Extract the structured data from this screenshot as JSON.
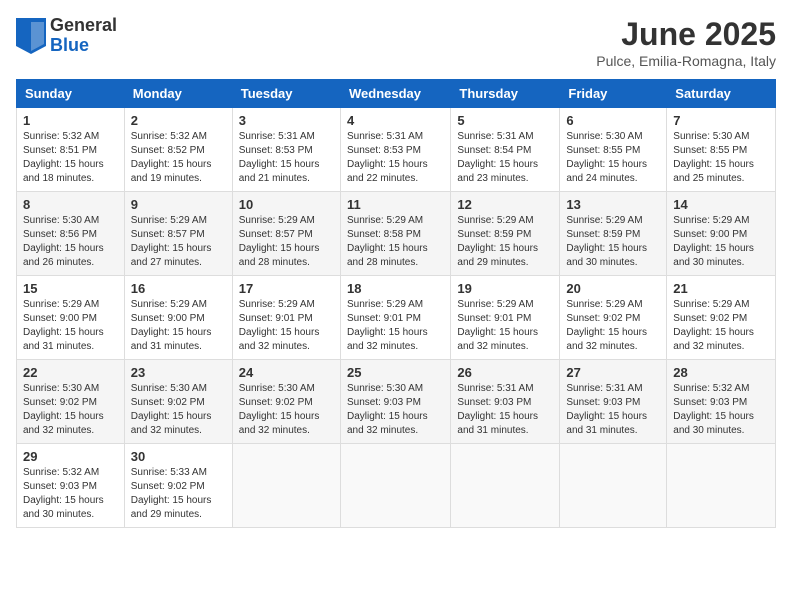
{
  "header": {
    "logo_general": "General",
    "logo_blue": "Blue",
    "month_title": "June 2025",
    "location": "Pulce, Emilia-Romagna, Italy"
  },
  "columns": [
    "Sunday",
    "Monday",
    "Tuesday",
    "Wednesday",
    "Thursday",
    "Friday",
    "Saturday"
  ],
  "weeks": [
    [
      {
        "day": "1",
        "info": "Sunrise: 5:32 AM\nSunset: 8:51 PM\nDaylight: 15 hours\nand 18 minutes."
      },
      {
        "day": "2",
        "info": "Sunrise: 5:32 AM\nSunset: 8:52 PM\nDaylight: 15 hours\nand 19 minutes."
      },
      {
        "day": "3",
        "info": "Sunrise: 5:31 AM\nSunset: 8:53 PM\nDaylight: 15 hours\nand 21 minutes."
      },
      {
        "day": "4",
        "info": "Sunrise: 5:31 AM\nSunset: 8:53 PM\nDaylight: 15 hours\nand 22 minutes."
      },
      {
        "day": "5",
        "info": "Sunrise: 5:31 AM\nSunset: 8:54 PM\nDaylight: 15 hours\nand 23 minutes."
      },
      {
        "day": "6",
        "info": "Sunrise: 5:30 AM\nSunset: 8:55 PM\nDaylight: 15 hours\nand 24 minutes."
      },
      {
        "day": "7",
        "info": "Sunrise: 5:30 AM\nSunset: 8:55 PM\nDaylight: 15 hours\nand 25 minutes."
      }
    ],
    [
      {
        "day": "8",
        "info": "Sunrise: 5:30 AM\nSunset: 8:56 PM\nDaylight: 15 hours\nand 26 minutes."
      },
      {
        "day": "9",
        "info": "Sunrise: 5:29 AM\nSunset: 8:57 PM\nDaylight: 15 hours\nand 27 minutes."
      },
      {
        "day": "10",
        "info": "Sunrise: 5:29 AM\nSunset: 8:57 PM\nDaylight: 15 hours\nand 28 minutes."
      },
      {
        "day": "11",
        "info": "Sunrise: 5:29 AM\nSunset: 8:58 PM\nDaylight: 15 hours\nand 28 minutes."
      },
      {
        "day": "12",
        "info": "Sunrise: 5:29 AM\nSunset: 8:59 PM\nDaylight: 15 hours\nand 29 minutes."
      },
      {
        "day": "13",
        "info": "Sunrise: 5:29 AM\nSunset: 8:59 PM\nDaylight: 15 hours\nand 30 minutes."
      },
      {
        "day": "14",
        "info": "Sunrise: 5:29 AM\nSunset: 9:00 PM\nDaylight: 15 hours\nand 30 minutes."
      }
    ],
    [
      {
        "day": "15",
        "info": "Sunrise: 5:29 AM\nSunset: 9:00 PM\nDaylight: 15 hours\nand 31 minutes."
      },
      {
        "day": "16",
        "info": "Sunrise: 5:29 AM\nSunset: 9:00 PM\nDaylight: 15 hours\nand 31 minutes."
      },
      {
        "day": "17",
        "info": "Sunrise: 5:29 AM\nSunset: 9:01 PM\nDaylight: 15 hours\nand 32 minutes."
      },
      {
        "day": "18",
        "info": "Sunrise: 5:29 AM\nSunset: 9:01 PM\nDaylight: 15 hours\nand 32 minutes."
      },
      {
        "day": "19",
        "info": "Sunrise: 5:29 AM\nSunset: 9:01 PM\nDaylight: 15 hours\nand 32 minutes."
      },
      {
        "day": "20",
        "info": "Sunrise: 5:29 AM\nSunset: 9:02 PM\nDaylight: 15 hours\nand 32 minutes."
      },
      {
        "day": "21",
        "info": "Sunrise: 5:29 AM\nSunset: 9:02 PM\nDaylight: 15 hours\nand 32 minutes."
      }
    ],
    [
      {
        "day": "22",
        "info": "Sunrise: 5:30 AM\nSunset: 9:02 PM\nDaylight: 15 hours\nand 32 minutes."
      },
      {
        "day": "23",
        "info": "Sunrise: 5:30 AM\nSunset: 9:02 PM\nDaylight: 15 hours\nand 32 minutes."
      },
      {
        "day": "24",
        "info": "Sunrise: 5:30 AM\nSunset: 9:02 PM\nDaylight: 15 hours\nand 32 minutes."
      },
      {
        "day": "25",
        "info": "Sunrise: 5:30 AM\nSunset: 9:03 PM\nDaylight: 15 hours\nand 32 minutes."
      },
      {
        "day": "26",
        "info": "Sunrise: 5:31 AM\nSunset: 9:03 PM\nDaylight: 15 hours\nand 31 minutes."
      },
      {
        "day": "27",
        "info": "Sunrise: 5:31 AM\nSunset: 9:03 PM\nDaylight: 15 hours\nand 31 minutes."
      },
      {
        "day": "28",
        "info": "Sunrise: 5:32 AM\nSunset: 9:03 PM\nDaylight: 15 hours\nand 30 minutes."
      }
    ],
    [
      {
        "day": "29",
        "info": "Sunrise: 5:32 AM\nSunset: 9:03 PM\nDaylight: 15 hours\nand 30 minutes."
      },
      {
        "day": "30",
        "info": "Sunrise: 5:33 AM\nSunset: 9:02 PM\nDaylight: 15 hours\nand 29 minutes."
      },
      {
        "day": "",
        "info": ""
      },
      {
        "day": "",
        "info": ""
      },
      {
        "day": "",
        "info": ""
      },
      {
        "day": "",
        "info": ""
      },
      {
        "day": "",
        "info": ""
      }
    ]
  ]
}
